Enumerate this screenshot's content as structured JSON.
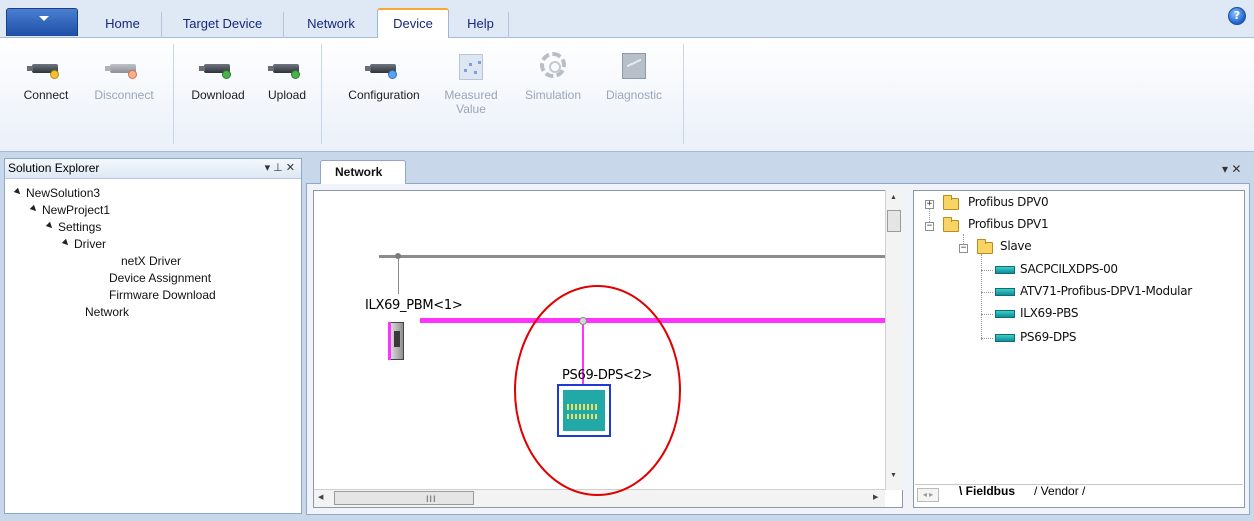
{
  "ribbon_tabs": [
    "Home",
    "Target Device",
    "Network",
    "Device",
    "Help"
  ],
  "active_tab": "Device",
  "ribbon_buttons": {
    "connect": "Connect",
    "disconnect": "Disconnect",
    "download": "Download",
    "upload": "Upload",
    "configuration": "Configuration",
    "measured_value_line1": "Measured",
    "measured_value_line2": "Value",
    "simulation": "Simulation",
    "diagnostic": "Diagnostic"
  },
  "solution_explorer": {
    "title": "Solution Explorer",
    "controls": "▾ ⊥ ✕",
    "items": [
      "NewSolution3",
      "NewProject1",
      "Settings",
      "Driver",
      "netX Driver",
      "Device Assignment",
      "Firmware Download",
      "Network"
    ]
  },
  "document": {
    "tab": "Network",
    "controls": "▾ ✕"
  },
  "network": {
    "device1_label": "ILX69_PBM<1>",
    "device2_label": "PS69-DPS<2>",
    "scroll_grip": "III"
  },
  "catalog": {
    "items": [
      "Profibus DPV0",
      "Profibus DPV1",
      "Slave",
      "SACPCILXDPS-00",
      "ATV71-Profibus-DPV1-Modular",
      "ILX69-PBS",
      "PS69-DPS"
    ],
    "tabs": [
      "Fieldbus",
      "Vendor"
    ],
    "nav": "◂ ▸"
  },
  "colors": {
    "profibus_bus": "#ff33ff",
    "ethernet_bus": "#8c8c8c",
    "selection": "#1f3ad4",
    "highlight": "#e00000",
    "active_tab_accent": "#f4a932"
  },
  "icons": {
    "help": "?",
    "scroll_up": "▲",
    "scroll_down": "▼",
    "scroll_left": "◀",
    "scroll_right": "▶"
  }
}
